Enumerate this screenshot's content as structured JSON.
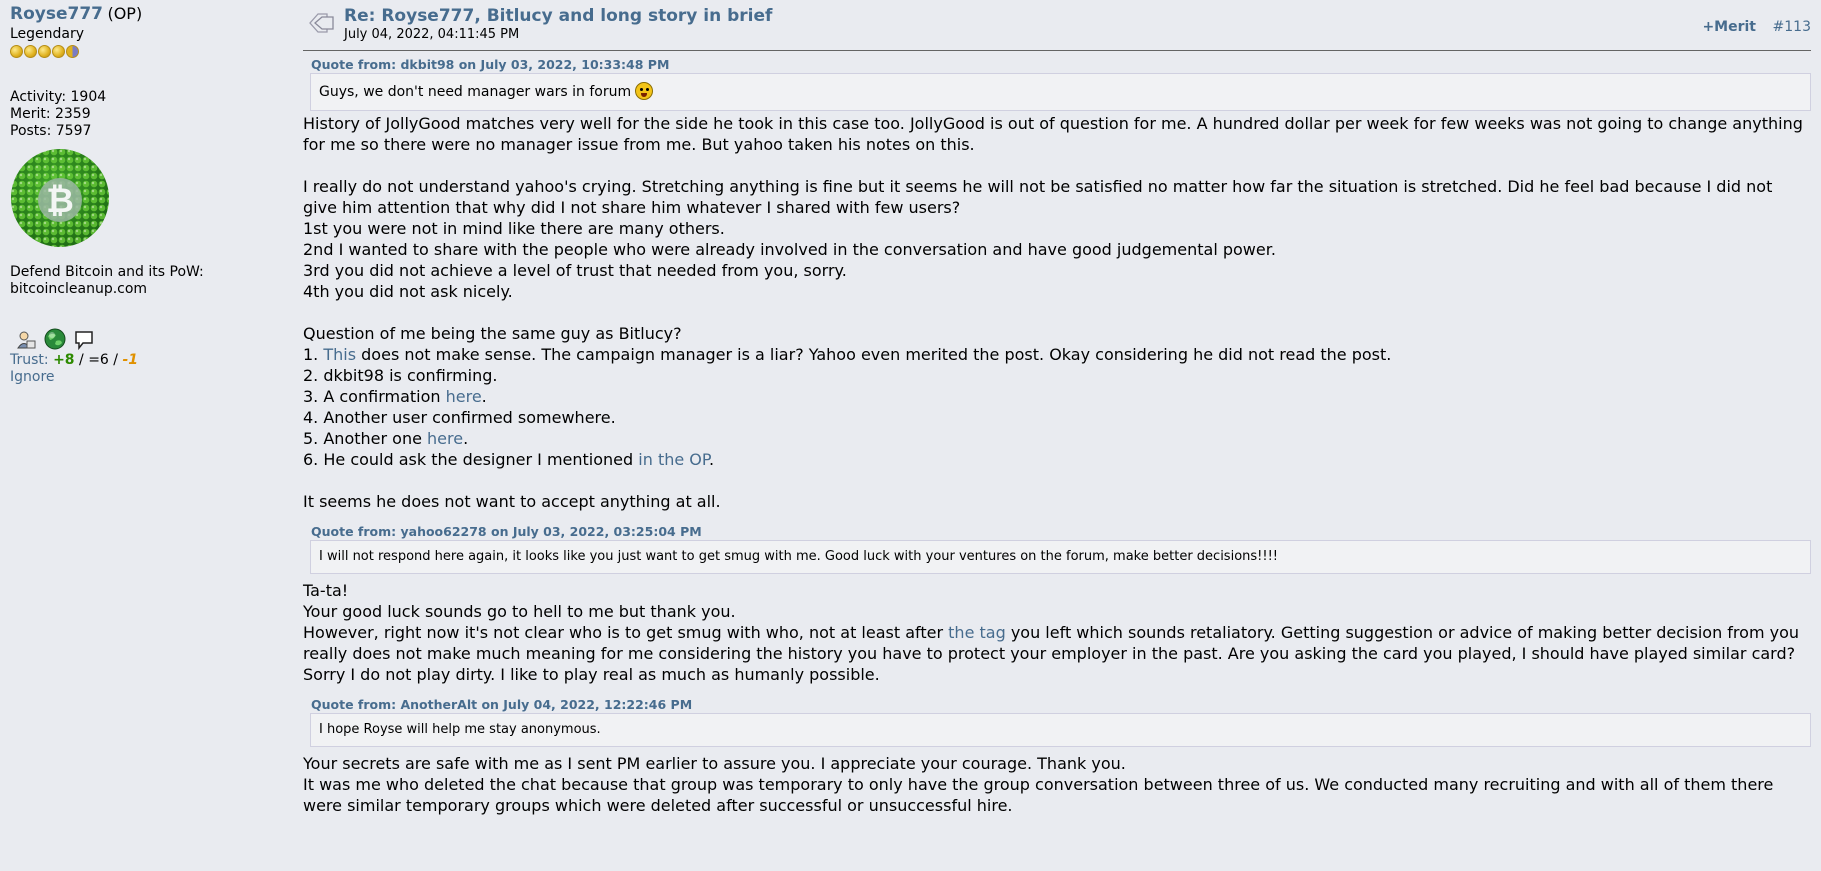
{
  "poster": {
    "username": "Royse777",
    "op_tag": "(OP)",
    "rank": "Legendary",
    "activity": "Activity: 1904",
    "merit": "Merit: 2359",
    "posts": "Posts: 7597",
    "signature_line1": "Defend Bitcoin and its PoW:",
    "signature_line2": "bitcoincleanup.com",
    "trust_label": "Trust:",
    "trust_positive": "+8",
    "trust_separator1": " / ",
    "trust_neutral": "=6",
    "trust_separator2": " / ",
    "trust_negative": "-1",
    "ignore": "Ignore",
    "colors": {
      "trust_positive": "#2d8a00",
      "trust_negative": "#e09100",
      "link": "#476c8e"
    }
  },
  "post": {
    "subject": "Re: Royse777, Bitlucy and long story in brief",
    "date": "July 04, 2022, 04:11:45 PM",
    "merit_button": "+Merit",
    "post_number": "#113",
    "quote1": {
      "header": "Quote from: dkbit98 on July 03, 2022, 10:33:48 PM",
      "text": "Guys, we don't need manager wars in forum"
    },
    "p1": "History of JollyGood matches very well for the side he took in this case too. JollyGood is out of question for me. A hundred dollar per week for few weeks was not going to change anything for me so there were no manager issue from me. But yahoo taken his notes on this.",
    "p2": [
      "I really do not understand yahoo's crying. Stretching anything is fine but it seems he will not be satisfied no matter how far the situation is stretched. Did he feel bad because I did not give him attention that why did I not share him whatever I shared with few users?",
      "1st you were not in mind like there are many others.",
      "2nd I wanted to share with the people who were already involved in the conversation and have good judgemental power.",
      "3rd you did not achieve a level of trust that needed from you, sorry.",
      "4th you did not ask nicely."
    ],
    "p3_title": "Question of me being the same guy as Bitlucy?",
    "list": {
      "i1_pre": "1. ",
      "i1_link": "This",
      "i1_post": " does not make sense. The campaign manager is a liar? Yahoo even merited the post. Okay considering he did not read the post.",
      "i2": "2. dkbit98 is confirming.",
      "i3_pre": "3. A confirmation ",
      "i3_link": "here",
      "i3_post": ".",
      "i4": "4. Another user confirmed somewhere.",
      "i5_pre": "5. Another one ",
      "i5_link": "here",
      "i5_post": ".",
      "i6_pre": "6. He could ask the designer I mentioned ",
      "i6_link": "in the OP",
      "i6_post": "."
    },
    "p4": "It seems he does not want to accept anything at all.",
    "quote2": {
      "header": "Quote from: yahoo62278 on July 03, 2022, 03:25:04 PM",
      "text": "I will not respond here again, it looks like you just want to get smug with me. Good luck with your ventures on the forum, make better decisions!!!!"
    },
    "p5": {
      "l1": "Ta-ta!",
      "l2": "Your good luck sounds go to hell to me but thank you.",
      "l3_pre": "However, right now it's not clear who is to get smug with who, not at least after ",
      "l3_link": "the tag",
      "l3_post": " you left which sounds retaliatory. Getting suggestion or advice of making better decision from you really does not make much meaning for me considering the history you have to protect your employer in the past. Are you asking the card you played, I should have played similar card? Sorry I do not play dirty. I like to play real as much as humanly possible."
    },
    "quote3": {
      "header": "Quote from: AnotherAlt on July 04, 2022, 12:22:46 PM",
      "text": "I hope Royse will help me stay anonymous."
    },
    "p6": [
      "Your secrets are safe with me as I sent PM earlier to assure you. I appreciate your courage. Thank you.",
      "It was me who deleted the chat because that group was temporary to only have the group conversation between three of us. We conducted many recruiting and with all of them there were similar temporary groups which were deleted after successful or unsuccessful hire."
    ]
  }
}
